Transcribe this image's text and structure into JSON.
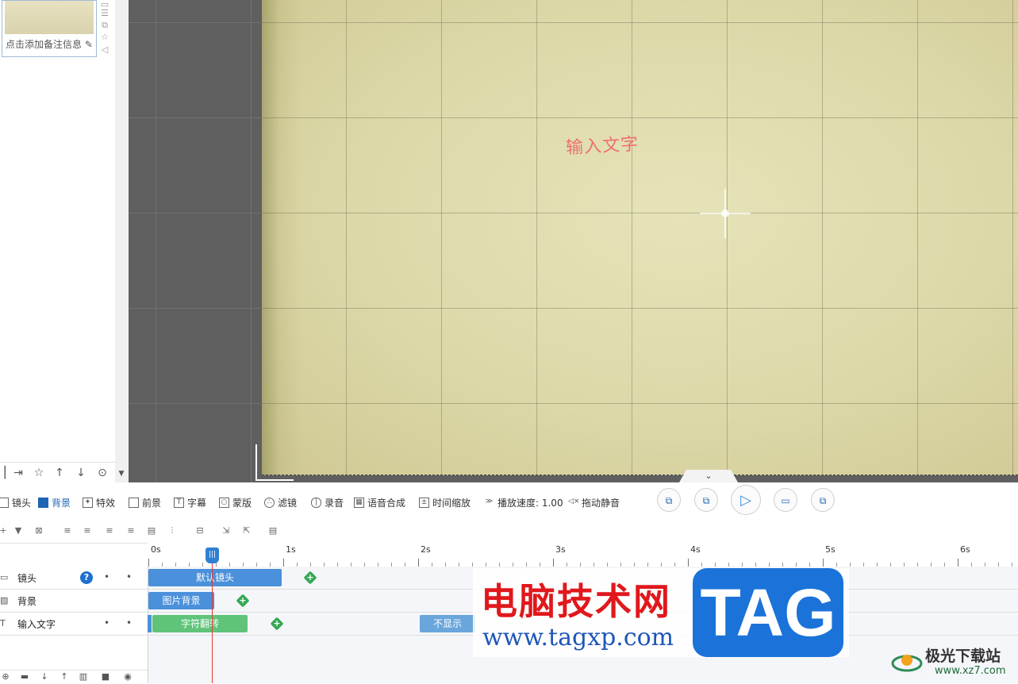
{
  "left_panel": {
    "note_placeholder": "点击添加备注信息",
    "side_icons": [
      "slide-icon",
      "layers-icon",
      "copy-icon",
      "star-icon",
      "sound-icon"
    ],
    "bottom_icons": [
      "export-icon",
      "star-icon",
      "up-arrow-icon",
      "down-arrow-icon",
      "more-icon"
    ]
  },
  "stage": {
    "text": "输入文字"
  },
  "toolbar": {
    "items": [
      {
        "label": "镜头",
        "icon": "camera-icon"
      },
      {
        "label": "背景",
        "icon": "background-icon"
      },
      {
        "label": "特效",
        "icon": "effect-icon"
      },
      {
        "label": "前景",
        "icon": "foreground-icon"
      },
      {
        "label": "字幕",
        "icon": "subtitle-icon"
      },
      {
        "label": "蒙版",
        "icon": "mask-icon"
      },
      {
        "label": "滤镜",
        "icon": "filter-icon"
      },
      {
        "label": "录音",
        "icon": "mic-icon"
      },
      {
        "label": "语音合成",
        "icon": "tts-icon"
      },
      {
        "label": "时间缩放",
        "icon": "time-scale-icon"
      },
      {
        "label": "播放速度: 1.00",
        "icon": "speed-icon"
      },
      {
        "label": "拖动静音",
        "icon": "mute-icon"
      }
    ]
  },
  "timeline": {
    "ruler_labels": [
      "0s",
      "1s",
      "2s",
      "3s",
      "4s",
      "5s",
      "6s"
    ],
    "tracks": [
      {
        "name": "镜头",
        "clips": [
          {
            "label": "默认镜头"
          }
        ]
      },
      {
        "name": "背景",
        "clips": [
          {
            "label": "图片背景"
          }
        ]
      },
      {
        "name": "输入文字",
        "clips": [
          {
            "label": "字符翻转"
          },
          {
            "label": "不显示"
          }
        ]
      }
    ],
    "playhead_time_s": 0.47
  },
  "watermark": {
    "cn": "电脑技术网",
    "url": "www.tagxp.com",
    "tag": "TAG",
    "site2_cn": "极光下载站",
    "site2_url": "www.xz7.com"
  },
  "colors": {
    "accent": "#1e64b4",
    "clip_blue": "#4b90da",
    "clip_green": "#5fc47a",
    "playhead": "#e53935"
  }
}
